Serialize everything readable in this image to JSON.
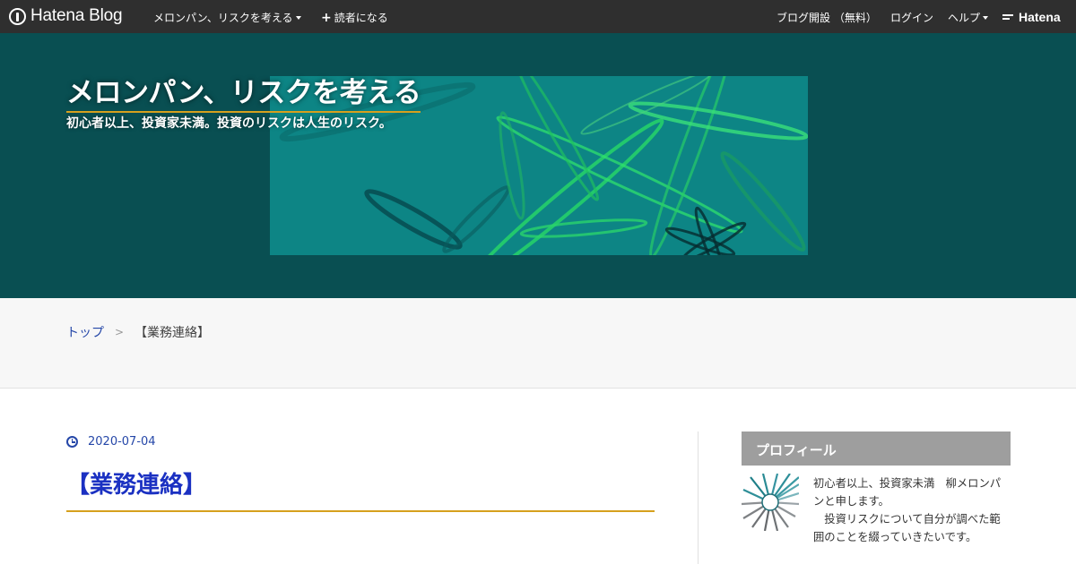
{
  "topbar": {
    "brand": "Hatena Blog",
    "blog_menu": "メロンパン、リスクを考える",
    "subscribe": "読者になる",
    "open_blog": "ブログ開設 （無料）",
    "login": "ログイン",
    "help": "ヘルプ",
    "hatena": "Hatena",
    "background": "#2f2f2f"
  },
  "header": {
    "title": "メロンパン、リスクを考える",
    "description": "初心者以上、投資家未満。投資のリスクは人生のリスク。",
    "background": "#094f52",
    "accent": "#d6a01e"
  },
  "breadcrumb": {
    "top": "トップ",
    "separator": ">",
    "current": "【業務連絡】"
  },
  "entry": {
    "date": "2020-07-04",
    "title": "【業務連絡】",
    "title_color": "#1b31c2",
    "icon": "clock-icon"
  },
  "sidebar": {
    "profile_heading": "プロフィール",
    "profile_line1": "初心者以上、投資家未満　柳メロンパンと申します。",
    "profile_line2": "　投資リスクについて自分が調べた範囲のことを綴っていきたいです。",
    "avatar_icon": "spiral-avatar-icon"
  }
}
